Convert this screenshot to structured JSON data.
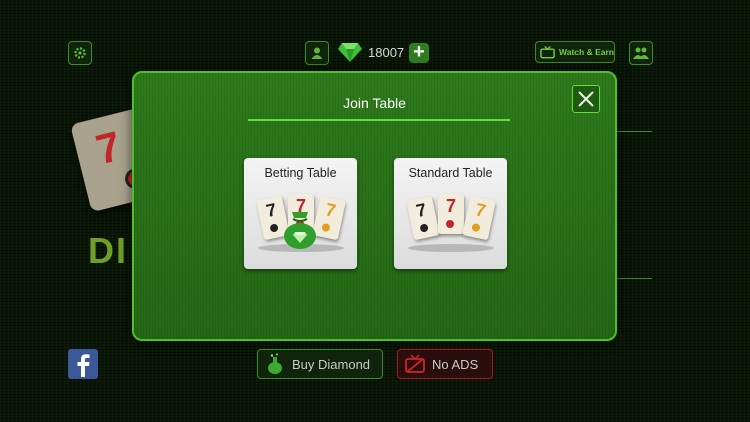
{
  "topbar": {
    "diamond_count": "18007",
    "watch_earn_label": "Watch & Earn",
    "icons": [
      "gear-icon",
      "user-icon",
      "diamond-icon",
      "plus-icon",
      "tv-icon",
      "group-icon"
    ]
  },
  "background": {
    "logo_text": "DI",
    "tile_number": "7"
  },
  "modal": {
    "title": "Join Table",
    "close_icon": "close-icon",
    "options": [
      {
        "label": "Betting Table",
        "tiles": [
          "7",
          "7",
          "7"
        ]
      },
      {
        "label": "Standard Table",
        "tiles": [
          "7",
          "7",
          "7"
        ]
      }
    ]
  },
  "bottom": {
    "buy_label": "Buy Diamond",
    "noads_label": "No ADS"
  },
  "colors": {
    "accent": "#4ec02b",
    "modal_bg": "#2e7a1b",
    "tile_black": "#222222",
    "tile_red": "#c0262b",
    "tile_orange": "#e0a020",
    "bag_green": "#2f9e2a"
  }
}
